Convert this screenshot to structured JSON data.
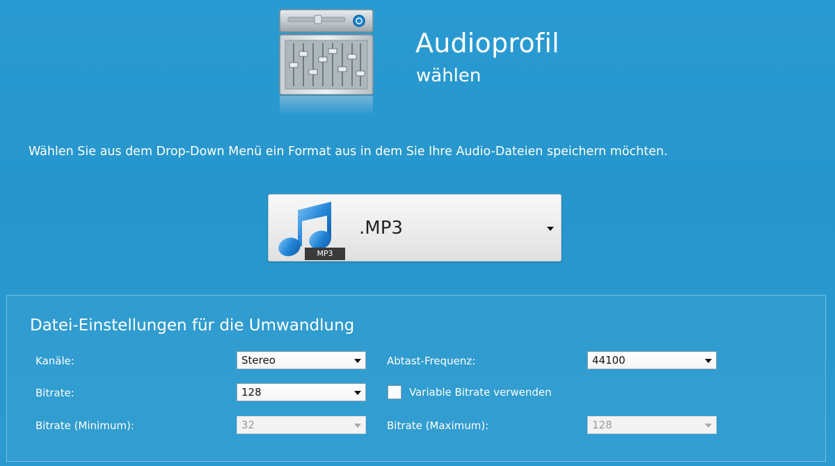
{
  "header": {
    "title": "Audioprofil",
    "subtitle": "wählen",
    "icon": "audio-mixer-icon"
  },
  "instruction": "Wählen Sie aus dem Drop-Down Menü ein Format aus in dem Sie Ihre Audio-Dateien speichern möchten.",
  "format_select": {
    "value": ".MP3",
    "badge": "MP3",
    "icon": "music-note-icon"
  },
  "settings": {
    "title": "Datei-Einstellungen für die Umwandlung",
    "channels": {
      "label": "Kanäle:",
      "value": "Stereo"
    },
    "sample_rate": {
      "label": "Abtast-Frequenz:",
      "value": "44100"
    },
    "bitrate": {
      "label": "Bitrate:",
      "value": "128"
    },
    "variable_bitrate": {
      "label": "Variable Bitrate verwenden",
      "checked": false
    },
    "bitrate_min": {
      "label": "Bitrate (Minimum):",
      "value": "32",
      "disabled": true
    },
    "bitrate_max": {
      "label": "Bitrate (Maximum):",
      "value": "128",
      "disabled": true
    }
  },
  "colors": {
    "background": "#2696cd",
    "accent_blue": "#1e7fd0"
  }
}
